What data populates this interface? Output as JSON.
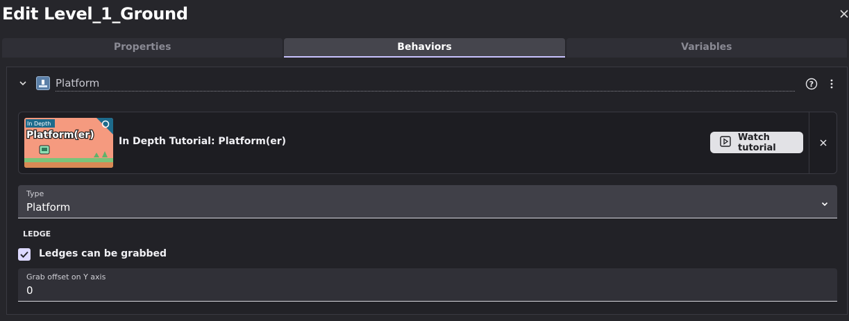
{
  "dialog": {
    "title": "Edit Level_1_Ground"
  },
  "tabs": [
    {
      "label": "Properties",
      "active": false
    },
    {
      "label": "Behaviors",
      "active": true
    },
    {
      "label": "Variables",
      "active": false
    }
  ],
  "behavior": {
    "name": "Platform",
    "icon": "platform-behavior-icon"
  },
  "tutorial": {
    "thumbnail_badge": "In Depth",
    "thumbnail_title": "Platform(er)",
    "title": "In Depth Tutorial: Platform(er)",
    "watch_label": "Watch tutorial"
  },
  "type_select": {
    "label": "Type",
    "value": "Platform"
  },
  "ledge": {
    "section_label": "LEDGE",
    "checkbox_label": "Ledges can be grabbed",
    "checked": true,
    "offset_label": "Grab offset on Y axis",
    "offset_value": "0"
  },
  "colors": {
    "accent": "#c9c3ff",
    "background": "#26262b",
    "panel": "#222227"
  }
}
